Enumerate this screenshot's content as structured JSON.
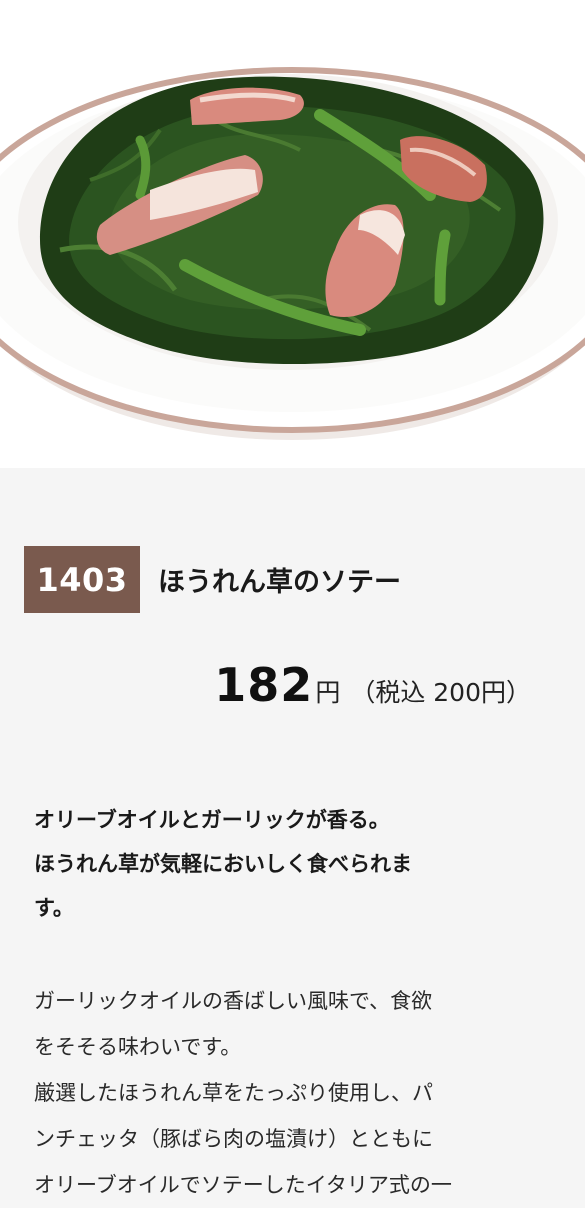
{
  "product": {
    "image_alt": "ほうれん草のソテー 写真",
    "number": "1403",
    "name": "ほうれん草のソテー",
    "price": {
      "amount": "182",
      "unit": "円",
      "tax_included": "（税込 200円）"
    },
    "lead_lines": [
      "オリーブオイルとガーリックが香る。",
      "ほうれん草が気軽においしく食べられま",
      "す。"
    ],
    "description_lines": [
      "ガーリックオイルの香ばしい風味で、食欲",
      "をそそる味わいです。",
      "厳選したほうれん草をたっぷり使用し、パ",
      "ンチェッタ（豚ばら肉の塩漬け）とともに",
      "オリーブオイルでソテーしたイタリア式の一"
    ]
  },
  "colors": {
    "badge_bg": "#7a5a4e",
    "page_bg": "#f5f5f5",
    "plate_rim": "#c9a69a",
    "spinach_dark": "#1f3d16",
    "pancetta": "#d98a7e"
  }
}
